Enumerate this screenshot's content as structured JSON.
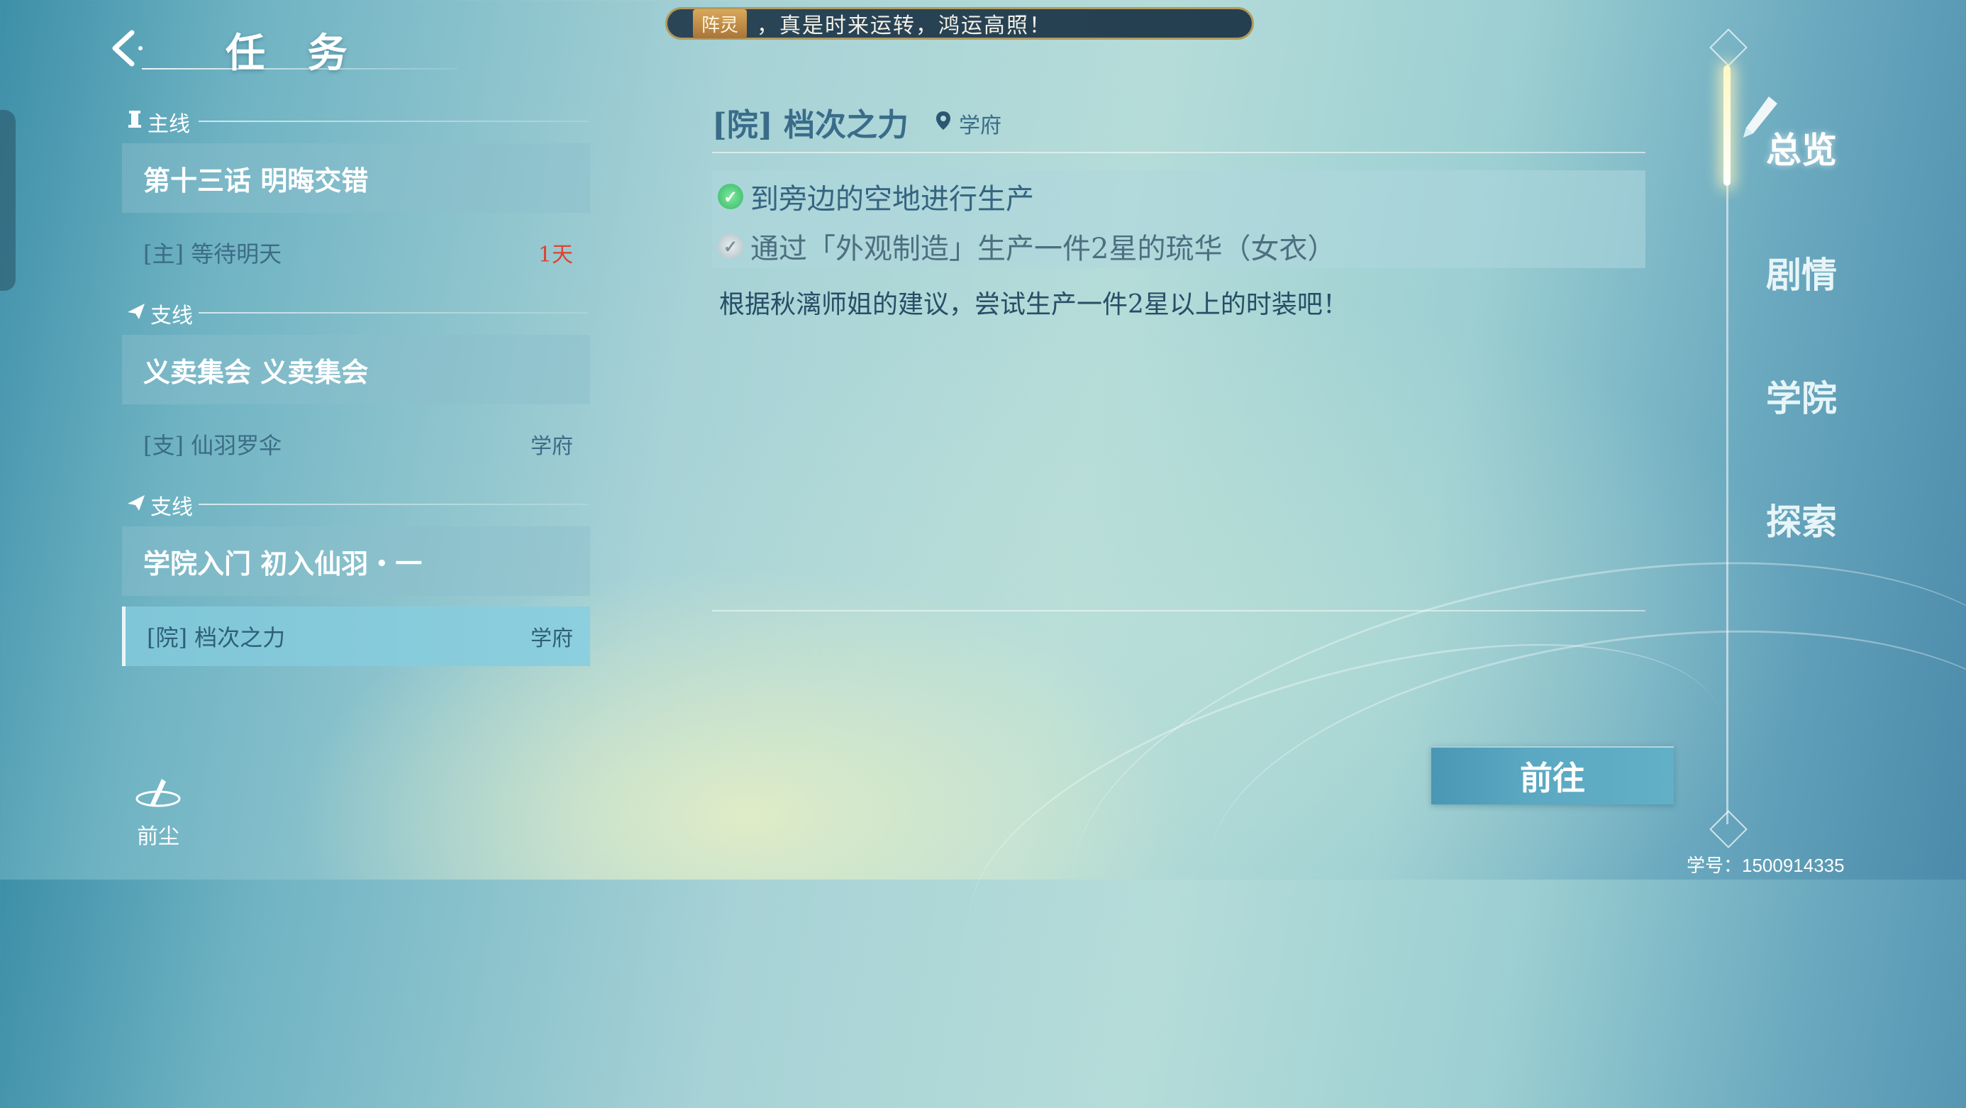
{
  "header": {
    "title": "任 务"
  },
  "banner": {
    "tag": "阵灵",
    "text": "，真是时来运转，鸿运高照！"
  },
  "sections": [
    {
      "label": "主线",
      "card": "第十三话  明晦交错",
      "row": {
        "label": "[主] 等待明天",
        "right": "1天"
      }
    },
    {
      "label": "支线",
      "card": "义卖集会  义卖集会",
      "row": {
        "label": "[支] 仙羽罗伞",
        "right": "学府"
      }
    },
    {
      "label": "支线",
      "card": "学院入门  初入仙羽・一",
      "row": {
        "label": "[院] 档次之力",
        "right": "学府"
      }
    }
  ],
  "bottom_left": {
    "label": "前尘"
  },
  "detail": {
    "title": "[院]  档次之力",
    "location": "学府",
    "goals": [
      {
        "text": "到旁边的空地进行生产",
        "done": true
      },
      {
        "text": "通过「外观制造」生产一件2星的琉华（女衣）",
        "done": false
      }
    ],
    "description": "根据秋漓师姐的建议，尝试生产一件2星以上的时装吧！",
    "go_button": "前往"
  },
  "right_tabs": {
    "active": "总览",
    "items": [
      "总览",
      "剧情",
      "学院",
      "探索"
    ]
  },
  "footer": {
    "student_id": "学号：1500914335"
  },
  "colors": {
    "accent_red": "#e0422f",
    "selected_row": "#8ccfde",
    "text_blue": "#3a6c8a"
  }
}
